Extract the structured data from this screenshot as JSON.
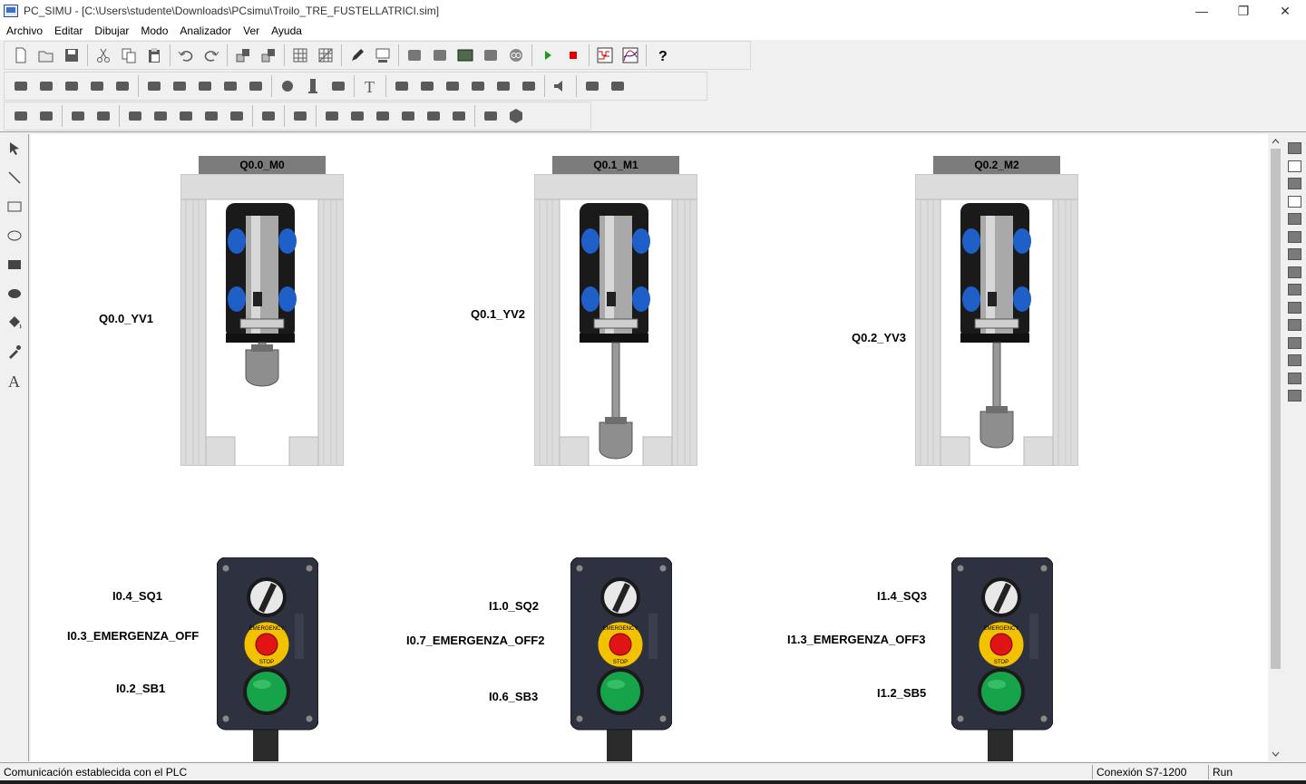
{
  "window": {
    "title": "PC_SIMU - [C:\\Users\\studente\\Downloads\\PCsimu\\Troilo_TRE_FUSTELLATRICI.sim]",
    "minimize": "—",
    "maximize": "❐",
    "close": "✕"
  },
  "menu": [
    "Archivo",
    "Editar",
    "Dibujar",
    "Modo",
    "Analizador",
    "Ver",
    "Ayuda"
  ],
  "toolbar": {
    "row1": [
      "new-icon",
      "open-icon",
      "save-icon",
      "sep",
      "cut-icon",
      "copy-icon",
      "paste-icon",
      "sep",
      "undo-icon",
      "redo-icon",
      "sep",
      "bring-front-icon",
      "send-back-icon",
      "sep",
      "grid-icon",
      "snap-grid-icon",
      "sep",
      "pencil-icon",
      "display-icon",
      "sep",
      "plc-icon",
      "module-icon",
      "panel-icon",
      "block-icon",
      "link-icon",
      "sep",
      "run-icon",
      "stop-icon",
      "sep",
      "signal-analyzer-icon",
      "curve-analyzer-icon",
      "sep",
      "help-icon"
    ],
    "row2": [
      "dimension-icon",
      "line-tool-icon",
      "arc-icon",
      "cross-icon",
      "cylinder-tool-icon",
      "sep",
      "double-valve-icon",
      "rect-valve-icon",
      "rect-valve2-icon",
      "rect-valve3-icon",
      "flag-icon",
      "sep",
      "lamp-icon",
      "pillar-icon",
      "rect-block-icon",
      "sep",
      "text-tool-icon",
      "sep",
      "keypad-icon",
      "post-icon",
      "picture-icon",
      "gear-icon",
      "gear-in-icon",
      "gear-out-icon",
      "sep",
      "speaker-icon",
      "sep",
      "column-icon",
      "dashed-column-icon"
    ],
    "row3": [
      "motor-icon",
      "box3d-icon",
      "sep",
      "belt-icon",
      "chain-icon",
      "sep",
      "piston-icon",
      "roller-icon",
      "fan-icon",
      "robot-icon",
      "gripper-icon",
      "sep",
      "sensor-icon",
      "sep",
      "panel-strip-icon",
      "sep",
      "hopper-icon",
      "valve-icon",
      "bar-icon",
      "mixer-icon",
      "hatch-icon",
      "plate-icon",
      "sep",
      "elevator-icon",
      "hexagon-icon"
    ],
    "run_color": "#1a9c1a",
    "stop_color": "#e00000"
  },
  "left_tools": [
    "select-arrow-icon",
    "line-icon",
    "rectangle-icon",
    "ellipse-icon",
    "filled-rectangle-icon",
    "filled-ellipse-icon",
    "fill-bucket-icon",
    "eyedropper-icon",
    "text-icon"
  ],
  "text_tool_glyph": "A",
  "cylinders": [
    {
      "title": "Q0.0_M0",
      "label": "Q0.0_YV1",
      "extension": 0.0
    },
    {
      "title": "Q0.1_M1",
      "label": "Q0.1_YV2",
      "extension": 1.0
    },
    {
      "title": "Q0.2_M2",
      "label": "Q0.2_YV3",
      "extension": 0.85
    }
  ],
  "panels": [
    {
      "selector": "I0.4_SQ1",
      "emergency": "I0.3_EMERGENZA_OFF",
      "button": "I0.2_SB1"
    },
    {
      "selector": "I1.0_SQ2",
      "emergency": "I0.7_EMERGENZA_OFF2",
      "button": "I0.6_SB3"
    },
    {
      "selector": "I1.4_SQ3",
      "emergency": "I1.3_EMERGENZA_OFF3",
      "button": "I1.2_SB5"
    }
  ],
  "emergency_text": {
    "top": "EMERGENCY",
    "bottom": "STOP"
  },
  "status": {
    "message": "Comunicación establecida con el PLC",
    "connection": "Conexión S7-1200",
    "mode": "Run"
  },
  "colors": {
    "title_bar_label": "#7c7c7c",
    "piston_blue": "#1f5fc8",
    "button_green": "#16a34a",
    "emergency_red": "#e01414",
    "emergency_yellow": "#f2c200"
  }
}
